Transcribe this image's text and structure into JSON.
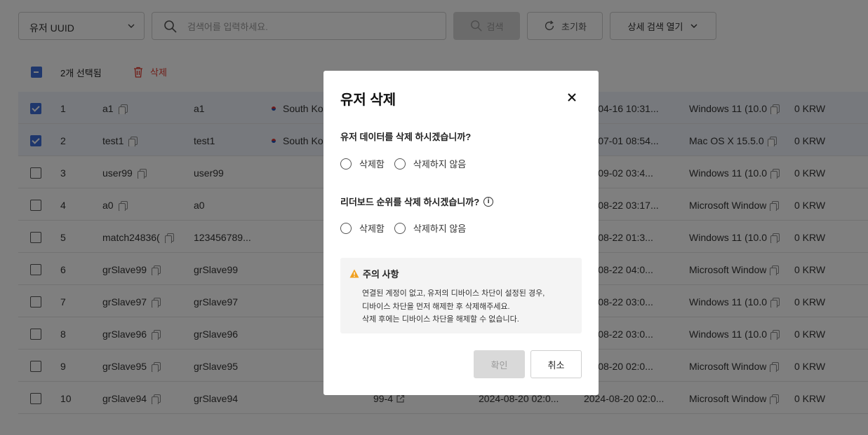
{
  "search": {
    "field_select": "유저 UUID",
    "placeholder": "검색어를 입력하세요.",
    "search_label": "검색",
    "reset_label": "초기화",
    "advanced_label": "상세 검색 열기"
  },
  "selection": {
    "count_label": "2개 선택됨",
    "delete_label": "삭제"
  },
  "rows": [
    {
      "num": "1",
      "uuid": "a1",
      "nick": "a1",
      "country": "South Ko",
      "a": "",
      "b": "",
      "login": "26-04-16 10:31...",
      "os": "Windows 11 (10.0",
      "currency": "0 KRW",
      "selected": true
    },
    {
      "num": "2",
      "uuid": "test1",
      "nick": "test1",
      "country": "South Ko",
      "a": "",
      "b": "",
      "login": "25-07-01 08:54...",
      "os": "Mac OS X 15.5.0",
      "currency": "0 KRW",
      "selected": true
    },
    {
      "num": "3",
      "uuid": "user99",
      "nick": "user99",
      "country": "",
      "a": "",
      "b": "",
      "login": "24-09-02 03:4...",
      "os": "Windows 11 (10.0",
      "currency": "0 KRW",
      "selected": false
    },
    {
      "num": "4",
      "uuid": "a0",
      "nick": "a0",
      "country": "",
      "a": "",
      "b": "",
      "login": "24-08-22 03:17...",
      "os": "Microsoft Window",
      "currency": "0 KRW",
      "selected": false
    },
    {
      "num": "5",
      "uuid": "match24836(",
      "nick": "123456789...",
      "country": "",
      "a": "",
      "b": "",
      "login": "24-08-22 01:3...",
      "os": "Windows 11 (10.0",
      "currency": "0 KRW",
      "selected": false
    },
    {
      "num": "6",
      "uuid": "grSlave99",
      "nick": "grSlave99",
      "country": "",
      "a": "",
      "b": "",
      "login": "24-08-22 04:0...",
      "os": "Microsoft Window",
      "currency": "0 KRW",
      "selected": false
    },
    {
      "num": "7",
      "uuid": "grSlave97",
      "nick": "grSlave97",
      "country": "",
      "a": "",
      "b": "",
      "login": "24-08-22 03:0...",
      "os": "Windows 11 (10.0",
      "currency": "0 KRW",
      "selected": false
    },
    {
      "num": "8",
      "uuid": "grSlave96",
      "nick": "grSlave96",
      "country": "",
      "a": "",
      "b": "",
      "login": "24-08-22 03:0...",
      "os": "Windows 11 (10.0",
      "currency": "0 KRW",
      "selected": false
    },
    {
      "num": "9",
      "uuid": "grSlave95",
      "nick": "grSlave95",
      "country": "",
      "a": "",
      "b": "",
      "login": "24-08-20 02:0...",
      "os": "Microsoft Window",
      "currency": "0 KRW",
      "selected": false
    },
    {
      "num": "10",
      "uuid": "grSlave94",
      "nick": "grSlave94",
      "country": "",
      "a": "99-4",
      "b": "2024-08-20 02:0...",
      "login": "2024-08-20 02:0...",
      "os": "Microsoft Window",
      "currency": "0 KRW",
      "selected": false
    }
  ],
  "modal": {
    "title": "유저 삭제",
    "q1": "유저 데이터를 삭제 하시겠습니까?",
    "q2": "리더보드 순위를 삭제 하시겠습니까?",
    "opt_yes": "삭제함",
    "opt_no": "삭제하지 않음",
    "notice_title": "주의 사항",
    "notice_lines": [
      "연결된 계정이 없고, 유저의 디바이스 차단이 설정된 경우,",
      "디바이스 차단을 먼저 해제한 후 삭제해주세요.",
      "삭제 후에는 디바이스 차단을 해제할 수 없습니다."
    ],
    "confirm_label": "확인",
    "cancel_label": "취소"
  },
  "colors": {
    "accent": "#3e6fd8",
    "danger": "#e03a2f",
    "warning": "#f0a020"
  }
}
